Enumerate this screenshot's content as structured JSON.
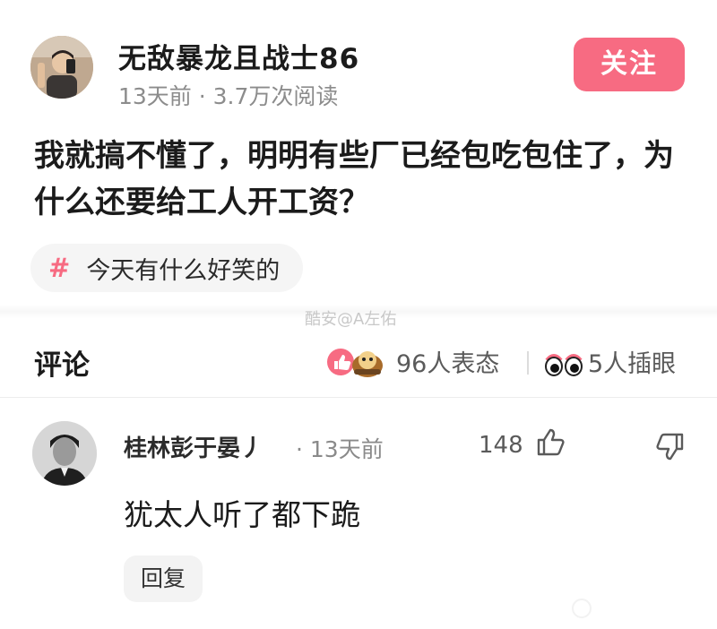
{
  "post": {
    "author": "无敌暴龙且战士86",
    "meta": "13天前 · 3.7万次阅读",
    "follow_label": "关注",
    "body": "我就搞不懂了，明明有些厂已经包吃包住了，为什么还要给工人开工资？",
    "topic_hash": "#",
    "topic": "今天有什么好笑的",
    "watermark": "酷安@A左佑"
  },
  "comments_bar": {
    "title": "评论",
    "reaction_count": "96人表态",
    "eyes_count": "5人插眼"
  },
  "comment": {
    "author": "桂林彭于晏丿",
    "time": "· 13天前",
    "likes": "148",
    "text": "犹太人听了都下跪",
    "reply_label": "回复"
  },
  "icons": {
    "like": "thumbs-up-icon",
    "dislike": "thumbs-down-icon",
    "reactions": "reaction-emoji-icons",
    "eyes": "eyes-icon"
  },
  "colors": {
    "accent": "#f76b82",
    "muted_text": "#8c8c8c"
  }
}
